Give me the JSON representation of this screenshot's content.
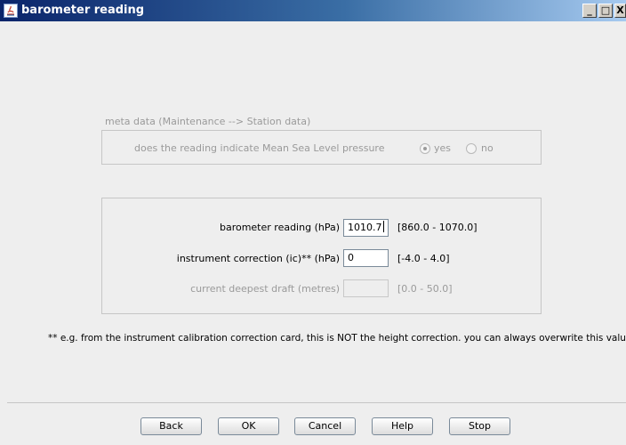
{
  "window": {
    "title": "barometer reading",
    "minimize_label": "_",
    "maximize_label": "□",
    "close_label": "X"
  },
  "meta": {
    "section_title": "meta data (Maintenance --> Station data)",
    "question": "does the reading indicate Mean Sea Level pressure",
    "options": [
      {
        "label": "yes",
        "selected": true
      },
      {
        "label": "no",
        "selected": false
      }
    ]
  },
  "fields": [
    {
      "label": "barometer reading (hPa)",
      "value": "1010.7",
      "range": "[860.0 - 1070.0]",
      "enabled": true
    },
    {
      "label": "instrument correction (ic)** (hPa)",
      "value": "0",
      "range": "[-4.0 - 4.0]",
      "enabled": true
    },
    {
      "label": "current deepest draft (metres)",
      "value": "",
      "range": "[0.0 - 50.0]",
      "enabled": false
    }
  ],
  "footnote": "** e.g. from the instrument calibration correction card, this is NOT the height correction. you can always overwrite this value",
  "buttons": {
    "back": "Back",
    "ok": "OK",
    "cancel": "Cancel",
    "help": "Help",
    "stop": "Stop"
  },
  "colors": {
    "title_bar_start": "#0a246a",
    "title_bar_end": "#a6caf0",
    "background": "#eeeeee",
    "disabled_text": "#9a9a9a"
  }
}
